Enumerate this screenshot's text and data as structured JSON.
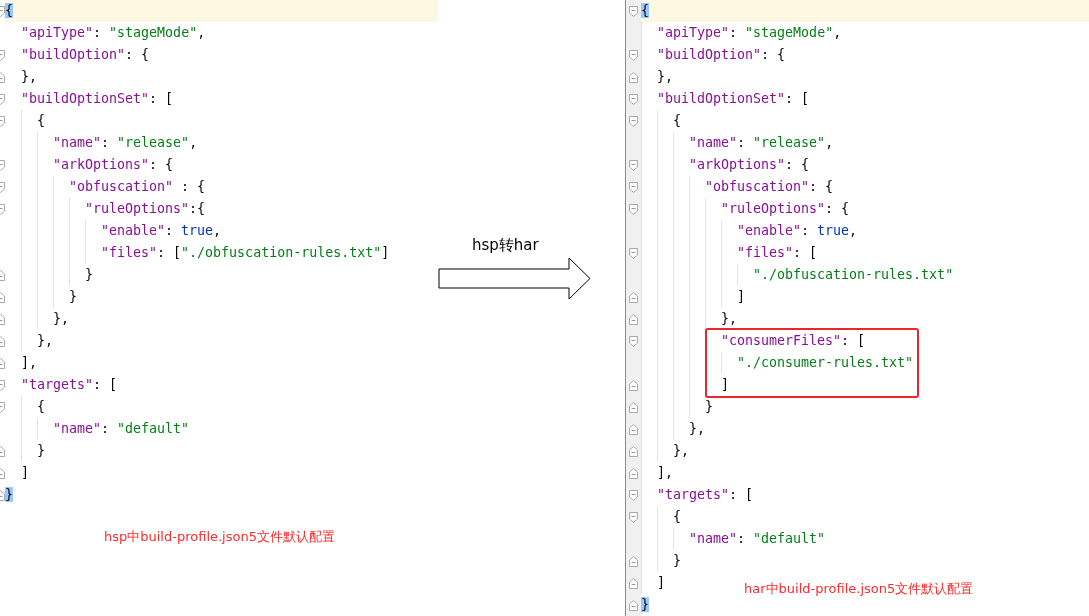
{
  "left_editor": {
    "lines": [
      {
        "kind": "fold-start",
        "current": true,
        "tokens": [
          {
            "kind": "brace",
            "t": "{"
          }
        ],
        "children": [
          {
            "kind": "plain",
            "tokens": [
              {
                "kind": "key",
                "t": "\"apiType\""
              },
              {
                "kind": "punct",
                "t": ": "
              },
              {
                "kind": "string",
                "t": "\"stageMode\""
              },
              {
                "kind": "punct",
                "t": ","
              }
            ]
          },
          {
            "kind": "fold-start",
            "tokens": [
              {
                "kind": "key",
                "t": "\"buildOption\""
              },
              {
                "kind": "punct",
                "t": ": {"
              }
            ]
          },
          {
            "kind": "fold-end",
            "tokens": [
              {
                "kind": "punct",
                "t": "},"
              }
            ]
          },
          {
            "kind": "fold-start",
            "tokens": [
              {
                "kind": "key",
                "t": "\"buildOptionSet\""
              },
              {
                "kind": "punct",
                "t": ": ["
              }
            ],
            "children": [
              {
                "kind": "fold-start",
                "tokens": [
                  {
                    "kind": "punct",
                    "t": "{"
                  }
                ],
                "children": [
                  {
                    "kind": "plain",
                    "tokens": [
                      {
                        "kind": "key",
                        "t": "\"name\""
                      },
                      {
                        "kind": "punct",
                        "t": ": "
                      },
                      {
                        "kind": "string",
                        "t": "\"release\""
                      },
                      {
                        "kind": "punct",
                        "t": ","
                      }
                    ]
                  },
                  {
                    "kind": "fold-start",
                    "tokens": [
                      {
                        "kind": "key",
                        "t": "\"arkOptions\""
                      },
                      {
                        "kind": "punct",
                        "t": ": {"
                      }
                    ],
                    "children": [
                      {
                        "kind": "fold-start",
                        "tokens": [
                          {
                            "kind": "key",
                            "t": "\"obfuscation\""
                          },
                          {
                            "kind": "punct",
                            "t": " : {"
                          }
                        ],
                        "children": [
                          {
                            "kind": "fold-start",
                            "tokens": [
                              {
                                "kind": "key",
                                "t": "\"ruleOptions\""
                              },
                              {
                                "kind": "punct",
                                "t": ":{"
                              }
                            ],
                            "children": [
                              {
                                "kind": "plain",
                                "tokens": [
                                  {
                                    "kind": "key",
                                    "t": "\"enable\""
                                  },
                                  {
                                    "kind": "punct",
                                    "t": ": "
                                  },
                                  {
                                    "kind": "keyword",
                                    "t": "true"
                                  },
                                  {
                                    "kind": "punct",
                                    "t": ","
                                  }
                                ]
                              },
                              {
                                "kind": "plain",
                                "tokens": [
                                  {
                                    "kind": "key",
                                    "t": "\"files\""
                                  },
                                  {
                                    "kind": "punct",
                                    "t": ": ["
                                  },
                                  {
                                    "kind": "string",
                                    "t": "\"./obfuscation-rules.txt\""
                                  },
                                  {
                                    "kind": "punct",
                                    "t": "]"
                                  }
                                ]
                              }
                            ]
                          },
                          {
                            "kind": "fold-end",
                            "tokens": [
                              {
                                "kind": "punct",
                                "t": "}"
                              }
                            ]
                          }
                        ]
                      },
                      {
                        "kind": "fold-end",
                        "tokens": [
                          {
                            "kind": "punct",
                            "t": "}"
                          }
                        ]
                      }
                    ]
                  },
                  {
                    "kind": "fold-end",
                    "tokens": [
                      {
                        "kind": "punct",
                        "t": "},"
                      }
                    ]
                  }
                ]
              },
              {
                "kind": "fold-end",
                "tokens": [
                  {
                    "kind": "punct",
                    "t": "},"
                  }
                ]
              }
            ]
          },
          {
            "kind": "fold-end",
            "tokens": [
              {
                "kind": "punct",
                "t": "],"
              }
            ]
          },
          {
            "kind": "fold-start",
            "tokens": [
              {
                "kind": "key",
                "t": "\"targets\""
              },
              {
                "kind": "punct",
                "t": ": ["
              }
            ],
            "children": [
              {
                "kind": "fold-start",
                "tokens": [
                  {
                    "kind": "punct",
                    "t": "{"
                  }
                ],
                "children": [
                  {
                    "kind": "plain",
                    "tokens": [
                      {
                        "kind": "key",
                        "t": "\"name\""
                      },
                      {
                        "kind": "punct",
                        "t": ": "
                      },
                      {
                        "kind": "string",
                        "t": "\"default\""
                      }
                    ]
                  }
                ]
              },
              {
                "kind": "fold-end",
                "tokens": [
                  {
                    "kind": "punct",
                    "t": "}"
                  }
                ]
              }
            ]
          },
          {
            "kind": "fold-end",
            "tokens": [
              {
                "kind": "punct",
                "t": "]"
              }
            ]
          }
        ]
      },
      {
        "kind": "fold-end",
        "tokens": [
          {
            "kind": "brace",
            "t": "}"
          }
        ]
      }
    ],
    "caption": "hsp中build-profile.json5文件默认配置"
  },
  "arrow": {
    "label": "hsp转har"
  },
  "right_editor": {
    "lines": [
      {
        "kind": "fold-start",
        "current": true,
        "tokens": [
          {
            "kind": "brace",
            "t": "{"
          }
        ],
        "children": [
          {
            "kind": "plain",
            "tokens": [
              {
                "kind": "key",
                "t": "\"apiType\""
              },
              {
                "kind": "punct",
                "t": ": "
              },
              {
                "kind": "string",
                "t": "\"stageMode\""
              },
              {
                "kind": "punct",
                "t": ","
              }
            ]
          },
          {
            "kind": "fold-start",
            "tokens": [
              {
                "kind": "key",
                "t": "\"buildOption\""
              },
              {
                "kind": "punct",
                "t": ": {"
              }
            ]
          },
          {
            "kind": "fold-end",
            "tokens": [
              {
                "kind": "punct",
                "t": "},"
              }
            ]
          },
          {
            "kind": "fold-start",
            "tokens": [
              {
                "kind": "key",
                "t": "\"buildOptionSet\""
              },
              {
                "kind": "punct",
                "t": ": ["
              }
            ],
            "children": [
              {
                "kind": "fold-start",
                "tokens": [
                  {
                    "kind": "punct",
                    "t": "{"
                  }
                ],
                "children": [
                  {
                    "kind": "plain",
                    "tokens": [
                      {
                        "kind": "key",
                        "t": "\"name\""
                      },
                      {
                        "kind": "punct",
                        "t": ": "
                      },
                      {
                        "kind": "string",
                        "t": "\"release\""
                      },
                      {
                        "kind": "punct",
                        "t": ","
                      }
                    ]
                  },
                  {
                    "kind": "fold-start",
                    "tokens": [
                      {
                        "kind": "key",
                        "t": "\"arkOptions\""
                      },
                      {
                        "kind": "punct",
                        "t": ": {"
                      }
                    ],
                    "children": [
                      {
                        "kind": "fold-start",
                        "tokens": [
                          {
                            "kind": "key",
                            "t": "\"obfuscation\""
                          },
                          {
                            "kind": "punct",
                            "t": ": {"
                          }
                        ],
                        "children": [
                          {
                            "kind": "fold-start",
                            "tokens": [
                              {
                                "kind": "key",
                                "t": "\"ruleOptions\""
                              },
                              {
                                "kind": "punct",
                                "t": ": {"
                              }
                            ],
                            "children": [
                              {
                                "kind": "plain",
                                "tokens": [
                                  {
                                    "kind": "key",
                                    "t": "\"enable\""
                                  },
                                  {
                                    "kind": "punct",
                                    "t": ": "
                                  },
                                  {
                                    "kind": "keyword",
                                    "t": "true"
                                  },
                                  {
                                    "kind": "punct",
                                    "t": ","
                                  }
                                ]
                              },
                              {
                                "kind": "fold-start",
                                "tokens": [
                                  {
                                    "kind": "key",
                                    "t": "\"files\""
                                  },
                                  {
                                    "kind": "punct",
                                    "t": ": ["
                                  }
                                ],
                                "children": [
                                  {
                                    "kind": "plain",
                                    "tokens": [
                                      {
                                        "kind": "string",
                                        "t": "\"./obfuscation-rules.txt\""
                                      }
                                    ]
                                  }
                                ]
                              },
                              {
                                "kind": "fold-end",
                                "tokens": [
                                  {
                                    "kind": "punct",
                                    "t": "]"
                                  }
                                ]
                              }
                            ]
                          },
                          {
                            "kind": "fold-end",
                            "tokens": [
                              {
                                "kind": "punct",
                                "t": "},"
                              }
                            ]
                          },
                          {
                            "kind": "box",
                            "lines": [
                              {
                                "kind": "fold-start",
                                "tokens": [
                                  {
                                    "kind": "key",
                                    "t": "\"consumerFiles\""
                                  },
                                  {
                                    "kind": "punct",
                                    "t": ": ["
                                  }
                                ],
                                "children": [
                                  {
                                    "kind": "plain",
                                    "tokens": [
                                      {
                                        "kind": "string",
                                        "t": "\"./consumer-rules.txt\""
                                      }
                                    ]
                                  }
                                ]
                              },
                              {
                                "kind": "fold-end",
                                "tokens": [
                                  {
                                    "kind": "punct",
                                    "t": "]"
                                  }
                                ]
                              }
                            ]
                          }
                        ]
                      },
                      {
                        "kind": "fold-end",
                        "tokens": [
                          {
                            "kind": "punct",
                            "t": "}"
                          }
                        ]
                      }
                    ]
                  },
                  {
                    "kind": "fold-end",
                    "tokens": [
                      {
                        "kind": "punct",
                        "t": "},"
                      }
                    ]
                  }
                ]
              },
              {
                "kind": "fold-end",
                "tokens": [
                  {
                    "kind": "punct",
                    "t": "},"
                  }
                ]
              }
            ]
          },
          {
            "kind": "fold-end",
            "tokens": [
              {
                "kind": "punct",
                "t": "],"
              }
            ]
          },
          {
            "kind": "fold-start",
            "tokens": [
              {
                "kind": "key",
                "t": "\"targets\""
              },
              {
                "kind": "punct",
                "t": ": ["
              }
            ],
            "children": [
              {
                "kind": "fold-start",
                "tokens": [
                  {
                    "kind": "punct",
                    "t": "{"
                  }
                ],
                "children": [
                  {
                    "kind": "plain",
                    "tokens": [
                      {
                        "kind": "key",
                        "t": "\"name\""
                      },
                      {
                        "kind": "punct",
                        "t": ": "
                      },
                      {
                        "kind": "string",
                        "t": "\"default\""
                      }
                    ]
                  }
                ]
              },
              {
                "kind": "fold-end",
                "tokens": [
                  {
                    "kind": "punct",
                    "t": "}"
                  }
                ]
              }
            ]
          },
          {
            "kind": "fold-end",
            "tokens": [
              {
                "kind": "punct",
                "t": "]"
              }
            ]
          }
        ]
      },
      {
        "kind": "fold-end",
        "tokens": [
          {
            "kind": "brace",
            "t": "}"
          }
        ]
      }
    ],
    "caption": "har中build-profile.json5文件默认配置"
  }
}
